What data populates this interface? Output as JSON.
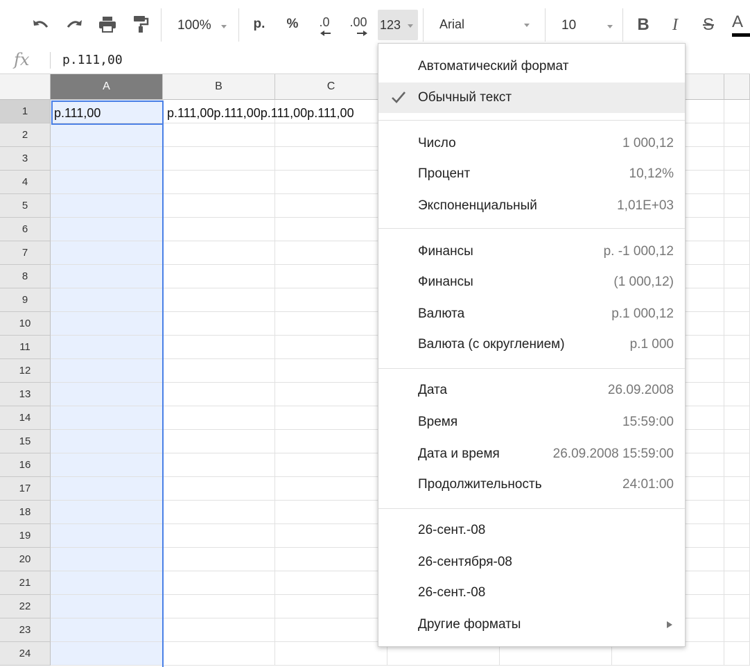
{
  "toolbar": {
    "zoom": "100%",
    "currency": "р.",
    "percent": "%",
    "decimal_decrease": ".0",
    "decimal_increase": ".00",
    "more_formats": "123",
    "font": "Arial",
    "font_size": "10",
    "bold": "B",
    "italic": "I",
    "strike": "S",
    "text_color": "A"
  },
  "formula_bar": {
    "fx": "fx",
    "value": "р.111,00"
  },
  "grid": {
    "columns": [
      "A",
      "B",
      "C"
    ],
    "rows": [
      "1",
      "2",
      "3",
      "4",
      "5",
      "6",
      "7",
      "8",
      "9",
      "10",
      "11",
      "12",
      "13",
      "14",
      "15",
      "16",
      "17",
      "18",
      "19",
      "20",
      "21",
      "22",
      "23",
      "24"
    ],
    "cell_a1": "р.111,00",
    "cell_b1": "р.111,00р.111,00р.111,00р.111,00"
  },
  "menu": {
    "auto": "Автоматический формат",
    "plain": "Обычный текст",
    "number": {
      "label": "Число",
      "example": "1 000,12"
    },
    "percent": {
      "label": "Процент",
      "example": "10,12%"
    },
    "scientific": {
      "label": "Экспоненциальный",
      "example": "1,01E+03"
    },
    "finance1": {
      "label": "Финансы",
      "example": "р. -1 000,12"
    },
    "finance2": {
      "label": "Финансы",
      "example": "(1 000,12)"
    },
    "currency": {
      "label": "Валюта",
      "example": "р.1 000,12"
    },
    "currency_rounded": {
      "label": "Валюта (с округлением)",
      "example": "р.1 000"
    },
    "date": {
      "label": "Дата",
      "example": "26.09.2008"
    },
    "time": {
      "label": "Время",
      "example": "15:59:00"
    },
    "datetime": {
      "label": "Дата и время",
      "example": "26.09.2008 15:59:00"
    },
    "duration": {
      "label": "Продолжительность",
      "example": "24:01:00"
    },
    "custom1": "26-сент.-08",
    "custom2": "26-сентября-08",
    "custom3": "26-сент.-08",
    "more": "Другие форматы"
  },
  "colors": {
    "selection": "#4a80e6",
    "selected_column_fill": "#e8f0fe",
    "selected_header": "#7d7d7d"
  }
}
